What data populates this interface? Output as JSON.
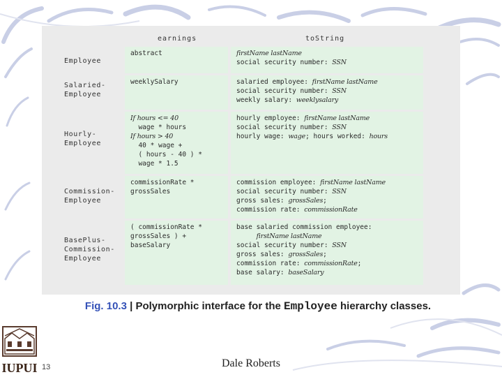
{
  "table": {
    "col_headers": [
      "earnings",
      "toString"
    ],
    "rows": [
      {
        "label": [
          "Employee"
        ],
        "earnings": [
          [
            {
              "t": "abstract",
              "i": false
            }
          ]
        ],
        "tostring": [
          [
            {
              "t": "firstName lastName",
              "i": true
            }
          ],
          [
            {
              "t": "social security number: ",
              "i": false
            },
            {
              "t": "SSN",
              "i": true
            }
          ]
        ]
      },
      {
        "label": [
          "Salaried-",
          "Employee"
        ],
        "earnings": [
          [
            {
              "t": "weeklySalary",
              "i": false
            }
          ]
        ],
        "tostring": [
          [
            {
              "t": "salaried employee: ",
              "i": false
            },
            {
              "t": "firstName lastName",
              "i": true
            }
          ],
          [
            {
              "t": "social security number: ",
              "i": false
            },
            {
              "t": "SSN",
              "i": true
            }
          ],
          [
            {
              "t": "weekly salary: ",
              "i": false
            },
            {
              "t": "weeklysalary",
              "i": true
            }
          ]
        ]
      },
      {
        "label": [
          "Hourly-",
          "Employee"
        ],
        "earnings": [
          [
            {
              "t": "If hours <= 40",
              "i": true
            }
          ],
          [
            {
              "t": "  wage * hours",
              "i": false
            }
          ],
          [
            {
              "t": "If hours > 40",
              "i": true
            }
          ],
          [
            {
              "t": "  40 * wage +",
              "i": false
            }
          ],
          [
            {
              "t": "  ( hours - 40 ) *",
              "i": false
            }
          ],
          [
            {
              "t": "  wage * 1.5",
              "i": false
            }
          ]
        ],
        "tostring": [
          [
            {
              "t": "hourly employee: ",
              "i": false
            },
            {
              "t": "firstName lastName",
              "i": true
            }
          ],
          [
            {
              "t": "social security number: ",
              "i": false
            },
            {
              "t": "SSN",
              "i": true
            }
          ],
          [
            {
              "t": "hourly wage: ",
              "i": false
            },
            {
              "t": "wage",
              "i": true
            },
            {
              "t": "; hours worked: ",
              "i": false
            },
            {
              "t": "hours",
              "i": true
            }
          ]
        ]
      },
      {
        "label": [
          "Commission-",
          "Employee"
        ],
        "earnings": [
          [
            {
              "t": "commissionRate *",
              "i": false
            }
          ],
          [
            {
              "t": "grossSales",
              "i": false
            }
          ]
        ],
        "tostring": [
          [
            {
              "t": "commission employee: ",
              "i": false
            },
            {
              "t": "firstName lastName",
              "i": true
            }
          ],
          [
            {
              "t": "social security number: ",
              "i": false
            },
            {
              "t": "SSN",
              "i": true
            }
          ],
          [
            {
              "t": "gross sales: ",
              "i": false
            },
            {
              "t": "grossSales",
              "i": true
            },
            {
              "t": ";",
              "i": false
            }
          ],
          [
            {
              "t": "commission rate: ",
              "i": false
            },
            {
              "t": "commissionRate",
              "i": true
            }
          ]
        ]
      },
      {
        "label": [
          "BasePlus-",
          "Commission-",
          "Employee"
        ],
        "earnings": [
          [
            {
              "t": "( commissionRate *",
              "i": false
            }
          ],
          [
            {
              "t": "grossSales ) +",
              "i": false
            }
          ],
          [
            {
              "t": "baseSalary",
              "i": false
            }
          ]
        ],
        "tostring": [
          [
            {
              "t": "base salaried commission employee:",
              "i": false
            }
          ],
          [
            {
              "t": "     ",
              "i": false
            },
            {
              "t": "firstName lastName",
              "i": true
            }
          ],
          [
            {
              "t": "social security number: ",
              "i": false
            },
            {
              "t": "SSN",
              "i": true
            }
          ],
          [
            {
              "t": "gross sales: ",
              "i": false
            },
            {
              "t": "grossSales",
              "i": true
            },
            {
              "t": ";",
              "i": false
            }
          ],
          [
            {
              "t": "commission rate: ",
              "i": false
            },
            {
              "t": "commissionRate",
              "i": true
            },
            {
              "t": ";",
              "i": false
            }
          ],
          [
            {
              "t": "base salary: ",
              "i": false
            },
            {
              "t": "baseSalary",
              "i": true
            }
          ]
        ]
      }
    ]
  },
  "caption": {
    "fig_label": "Fig. 10.3",
    "text_before": " | Polymorphic interface for the ",
    "code": "Employee",
    "text_after": " hierarchy classes."
  },
  "footer": {
    "slide_number": "13",
    "author": "Dale Roberts",
    "logo_text": "IUPUI"
  },
  "colors": {
    "cell_fill": "#e2f3e4",
    "panel_bg": "#ebebeb",
    "fig_label": "#3552b8"
  }
}
